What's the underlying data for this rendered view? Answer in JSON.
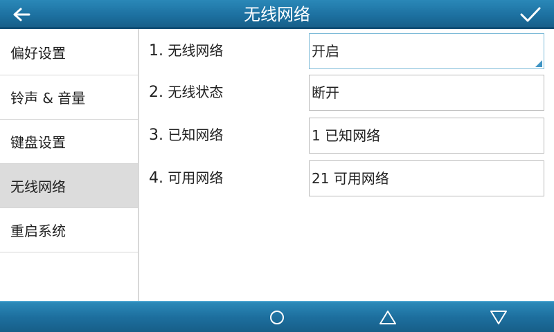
{
  "header": {
    "title": "无线网络",
    "back_icon": "back-arrow-icon",
    "ok_icon": "checkmark-icon"
  },
  "sidebar": {
    "items": [
      {
        "label": "偏好设置",
        "active": false
      },
      {
        "label": "铃声 & 音量",
        "active": false
      },
      {
        "label": "键盘设置",
        "active": false
      },
      {
        "label": "无线网络",
        "active": true
      },
      {
        "label": "重启系统",
        "active": false
      }
    ]
  },
  "main": {
    "rows": [
      {
        "num": "1.",
        "label": "无线网络",
        "value": "开启",
        "focused": true
      },
      {
        "num": "2.",
        "label": "无线状态",
        "value": "断开",
        "focused": false
      },
      {
        "num": "3.",
        "label": "已知网络",
        "value": "1 已知网络",
        "focused": false
      },
      {
        "num": "4.",
        "label": "可用网络",
        "value": "21 可用网络",
        "focused": false
      }
    ]
  },
  "navbar": {
    "icons": [
      "circle-home-icon",
      "triangle-up-icon",
      "triangle-down-icon"
    ]
  },
  "colors": {
    "header": "#1c6f9f",
    "active_item": "#dcdcdc",
    "focus_border": "#7dbad8",
    "dropdown_corner": "#3f94c4"
  }
}
